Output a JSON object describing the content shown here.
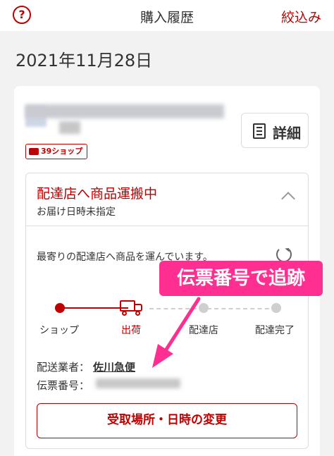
{
  "header": {
    "help_icon": "?",
    "title": "購入履歴",
    "filter_label": "絞込み"
  },
  "order": {
    "date": "2021年11月28日",
    "detail_label": "詳細",
    "shop_badge": "39ショップ"
  },
  "status": {
    "title": "配達店へ商品運搬中",
    "subtitle": "お届け日時未指定",
    "description": "最寄りの配達店へ商品を運んでいます。",
    "steps": [
      "ショップ",
      "出荷",
      "配達店",
      "配達完了"
    ],
    "current_step": 1,
    "carrier_label": "配送業者：",
    "carrier_value": "佐川急便",
    "tracking_label": "伝票番号："
  },
  "annotation": {
    "text": "伝票番号で追跡",
    "color": "#ff2f92"
  },
  "actions": {
    "change_button": "受取場所・日時の変更"
  },
  "colors": {
    "accent": "#bf0000",
    "inactive": "#cfcfcf"
  }
}
